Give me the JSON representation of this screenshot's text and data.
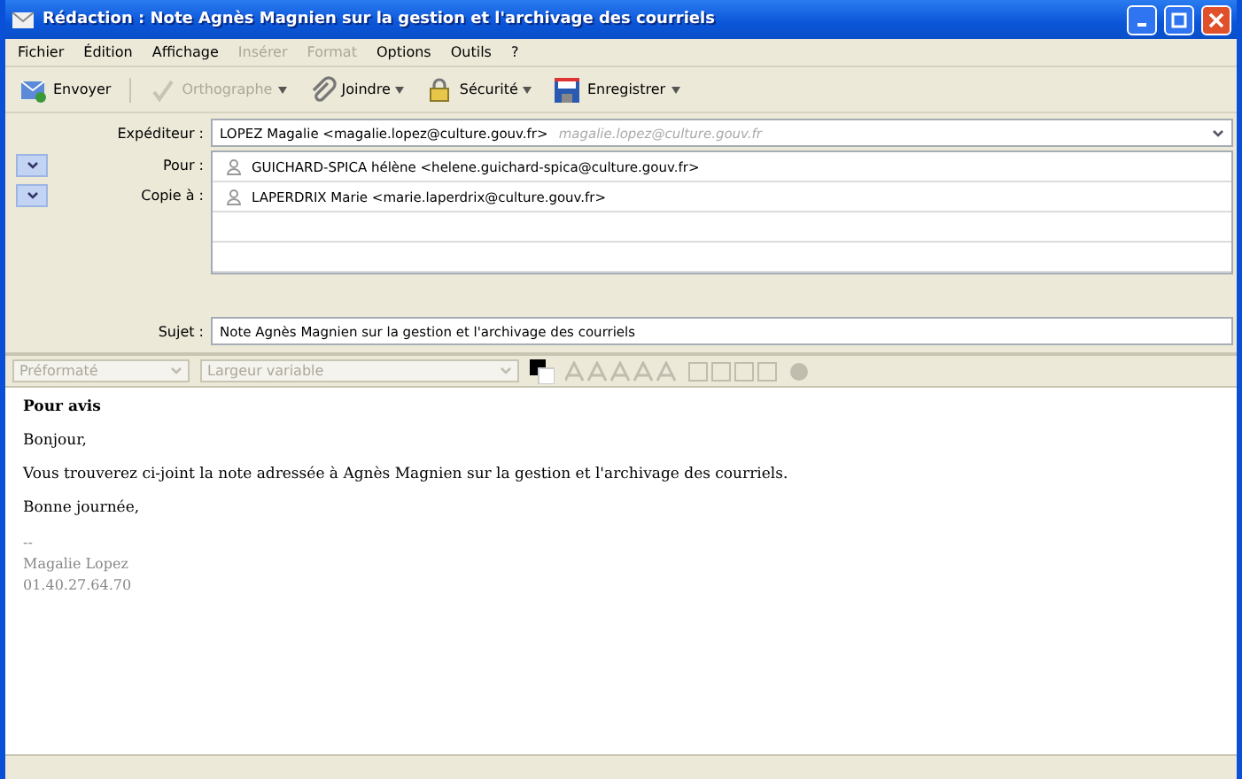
{
  "window": {
    "title": "Rédaction : Note Agnès Magnien sur la gestion et l'archivage des courriels"
  },
  "menu": [
    {
      "label": "Fichier",
      "disabled": false
    },
    {
      "label": "Édition",
      "disabled": false
    },
    {
      "label": "Affichage",
      "disabled": false
    },
    {
      "label": "Insérer",
      "disabled": true
    },
    {
      "label": "Format",
      "disabled": true
    },
    {
      "label": "Options",
      "disabled": false
    },
    {
      "label": "Outils",
      "disabled": false
    },
    {
      "label": "?",
      "disabled": false
    }
  ],
  "toolbar": [
    {
      "kind": "send",
      "label": "Envoyer",
      "disabled": false,
      "dropdown": false
    },
    {
      "kind": "spell",
      "label": "Orthographe",
      "disabled": true,
      "dropdown": true
    },
    {
      "kind": "attach",
      "label": "Joindre",
      "disabled": false,
      "dropdown": true
    },
    {
      "kind": "security",
      "label": "Sécurité",
      "disabled": false,
      "dropdown": true
    },
    {
      "kind": "save",
      "label": "Enregistrer",
      "disabled": false,
      "dropdown": true
    }
  ],
  "sender": {
    "label": "Expéditeur :",
    "value": "LOPEZ Magalie <magalie.lopez@culture.gouv.fr>",
    "hint": "magalie.lopez@culture.gouv.fr"
  },
  "recipients": [
    {
      "type": "Pour :",
      "value": "GUICHARD-SPICA hélène <helene.guichard-spica@culture.gouv.fr>"
    },
    {
      "type": "Copie à :",
      "value": "LAPERDRIX Marie <marie.laperdrix@culture.gouv.fr>"
    }
  ],
  "subject": {
    "label": "Sujet :",
    "value": "Note Agnès Magnien sur la gestion et l'archivage des courriels"
  },
  "format_bar": {
    "paragraph": "Préformaté",
    "font": "Largeur variable",
    "disabled": true
  },
  "body": [
    {
      "kind": "heading",
      "text": "Pour avis"
    },
    {
      "kind": "paragraph",
      "text": "Bonjour,"
    },
    {
      "kind": "paragraph",
      "text": "Vous trouverez ci-joint la note adressée à Agnès Magnien sur la gestion et l'archivage des courriels."
    },
    {
      "kind": "paragraph",
      "text": "Bonne journée,"
    },
    {
      "kind": "signature",
      "text": "--"
    },
    {
      "kind": "signature",
      "text": "Magalie Lopez"
    },
    {
      "kind": "signature",
      "text": "01.40.27.64.70"
    }
  ]
}
